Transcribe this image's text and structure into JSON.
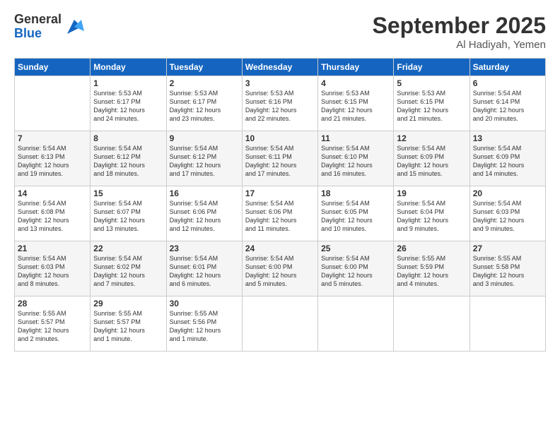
{
  "logo": {
    "general": "General",
    "blue": "Blue"
  },
  "title": {
    "main": "September 2025",
    "sub": "Al Hadiyah, Yemen"
  },
  "calendar": {
    "headers": [
      "Sunday",
      "Monday",
      "Tuesday",
      "Wednesday",
      "Thursday",
      "Friday",
      "Saturday"
    ],
    "rows": [
      [
        {
          "num": "",
          "info": ""
        },
        {
          "num": "1",
          "info": "Sunrise: 5:53 AM\nSunset: 6:17 PM\nDaylight: 12 hours\nand 24 minutes."
        },
        {
          "num": "2",
          "info": "Sunrise: 5:53 AM\nSunset: 6:17 PM\nDaylight: 12 hours\nand 23 minutes."
        },
        {
          "num": "3",
          "info": "Sunrise: 5:53 AM\nSunset: 6:16 PM\nDaylight: 12 hours\nand 22 minutes."
        },
        {
          "num": "4",
          "info": "Sunrise: 5:53 AM\nSunset: 6:15 PM\nDaylight: 12 hours\nand 21 minutes."
        },
        {
          "num": "5",
          "info": "Sunrise: 5:53 AM\nSunset: 6:15 PM\nDaylight: 12 hours\nand 21 minutes."
        },
        {
          "num": "6",
          "info": "Sunrise: 5:54 AM\nSunset: 6:14 PM\nDaylight: 12 hours\nand 20 minutes."
        }
      ],
      [
        {
          "num": "7",
          "info": "Sunrise: 5:54 AM\nSunset: 6:13 PM\nDaylight: 12 hours\nand 19 minutes."
        },
        {
          "num": "8",
          "info": "Sunrise: 5:54 AM\nSunset: 6:12 PM\nDaylight: 12 hours\nand 18 minutes."
        },
        {
          "num": "9",
          "info": "Sunrise: 5:54 AM\nSunset: 6:12 PM\nDaylight: 12 hours\nand 17 minutes."
        },
        {
          "num": "10",
          "info": "Sunrise: 5:54 AM\nSunset: 6:11 PM\nDaylight: 12 hours\nand 17 minutes."
        },
        {
          "num": "11",
          "info": "Sunrise: 5:54 AM\nSunset: 6:10 PM\nDaylight: 12 hours\nand 16 minutes."
        },
        {
          "num": "12",
          "info": "Sunrise: 5:54 AM\nSunset: 6:09 PM\nDaylight: 12 hours\nand 15 minutes."
        },
        {
          "num": "13",
          "info": "Sunrise: 5:54 AM\nSunset: 6:09 PM\nDaylight: 12 hours\nand 14 minutes."
        }
      ],
      [
        {
          "num": "14",
          "info": "Sunrise: 5:54 AM\nSunset: 6:08 PM\nDaylight: 12 hours\nand 13 minutes."
        },
        {
          "num": "15",
          "info": "Sunrise: 5:54 AM\nSunset: 6:07 PM\nDaylight: 12 hours\nand 13 minutes."
        },
        {
          "num": "16",
          "info": "Sunrise: 5:54 AM\nSunset: 6:06 PM\nDaylight: 12 hours\nand 12 minutes."
        },
        {
          "num": "17",
          "info": "Sunrise: 5:54 AM\nSunset: 6:06 PM\nDaylight: 12 hours\nand 11 minutes."
        },
        {
          "num": "18",
          "info": "Sunrise: 5:54 AM\nSunset: 6:05 PM\nDaylight: 12 hours\nand 10 minutes."
        },
        {
          "num": "19",
          "info": "Sunrise: 5:54 AM\nSunset: 6:04 PM\nDaylight: 12 hours\nand 9 minutes."
        },
        {
          "num": "20",
          "info": "Sunrise: 5:54 AM\nSunset: 6:03 PM\nDaylight: 12 hours\nand 9 minutes."
        }
      ],
      [
        {
          "num": "21",
          "info": "Sunrise: 5:54 AM\nSunset: 6:03 PM\nDaylight: 12 hours\nand 8 minutes."
        },
        {
          "num": "22",
          "info": "Sunrise: 5:54 AM\nSunset: 6:02 PM\nDaylight: 12 hours\nand 7 minutes."
        },
        {
          "num": "23",
          "info": "Sunrise: 5:54 AM\nSunset: 6:01 PM\nDaylight: 12 hours\nand 6 minutes."
        },
        {
          "num": "24",
          "info": "Sunrise: 5:54 AM\nSunset: 6:00 PM\nDaylight: 12 hours\nand 5 minutes."
        },
        {
          "num": "25",
          "info": "Sunrise: 5:54 AM\nSunset: 6:00 PM\nDaylight: 12 hours\nand 5 minutes."
        },
        {
          "num": "26",
          "info": "Sunrise: 5:55 AM\nSunset: 5:59 PM\nDaylight: 12 hours\nand 4 minutes."
        },
        {
          "num": "27",
          "info": "Sunrise: 5:55 AM\nSunset: 5:58 PM\nDaylight: 12 hours\nand 3 minutes."
        }
      ],
      [
        {
          "num": "28",
          "info": "Sunrise: 5:55 AM\nSunset: 5:57 PM\nDaylight: 12 hours\nand 2 minutes."
        },
        {
          "num": "29",
          "info": "Sunrise: 5:55 AM\nSunset: 5:57 PM\nDaylight: 12 hours\nand 1 minute."
        },
        {
          "num": "30",
          "info": "Sunrise: 5:55 AM\nSunset: 5:56 PM\nDaylight: 12 hours\nand 1 minute."
        },
        {
          "num": "",
          "info": ""
        },
        {
          "num": "",
          "info": ""
        },
        {
          "num": "",
          "info": ""
        },
        {
          "num": "",
          "info": ""
        }
      ]
    ]
  }
}
